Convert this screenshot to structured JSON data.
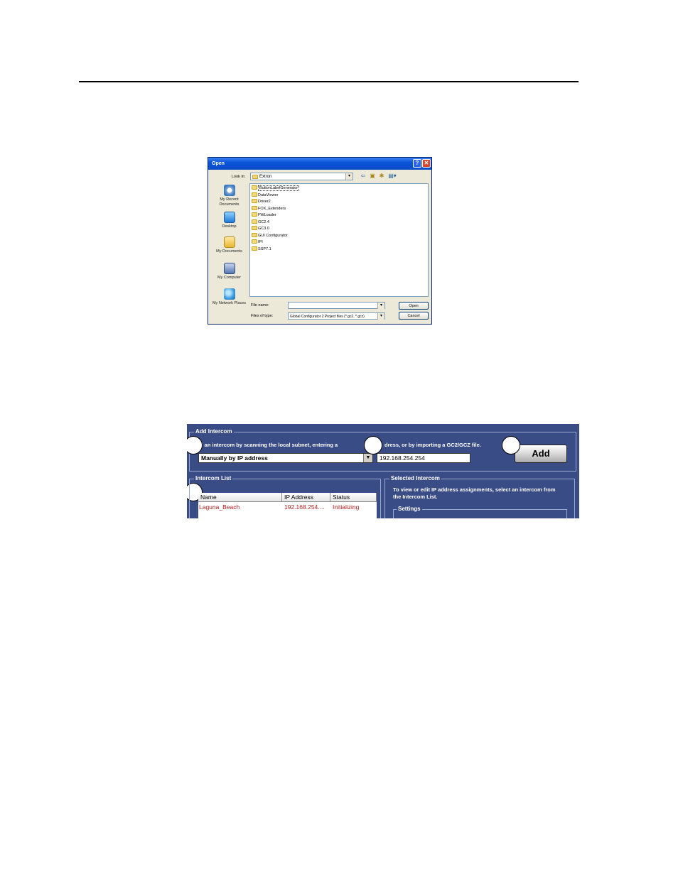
{
  "open_dialog": {
    "title": "Open",
    "look_in_label": "Look in:",
    "look_in_value": "Extron",
    "places": [
      "My Recent Documents",
      "Desktop",
      "My Documents",
      "My Computer",
      "My Network Places"
    ],
    "files": [
      "ButtonLabelGenerator",
      "DataViewer",
      "Driver2",
      "FOX_Extenders",
      "FWLoader",
      "GC2.4",
      "GC3.0",
      "GUI Configurator",
      "IPI",
      "SSP7.1"
    ],
    "file_name_label": "File name:",
    "file_name_value": "",
    "files_of_type_label": "Files of type:",
    "files_of_type_value": "Global Configurator 2 Project files (*.gc2, *.gcz)",
    "open_button": "Open",
    "cancel_button": "Cancel",
    "help_glyph": "?",
    "close_glyph": "✕"
  },
  "intercom": {
    "add_group_title": "Add Intercom",
    "instruction": "d an intercom by scanning the local subnet, entering a",
    "instruction_2": "dress, or by importing a GC2/GCZ file.",
    "method_value": "Manually by IP address",
    "ip_value": "192.168.254.254",
    "add_button": "Add",
    "list_title": "Intercom List",
    "columns": [
      "Name",
      "IP Address",
      "Status"
    ],
    "rows": [
      {
        "name": "Laguna_Beach",
        "ip": "192.168.254....",
        "status": "Initializing"
      }
    ],
    "selected_title": "Selected Intercom",
    "selected_text": "To view or edit IP address assignments, select an intercom from the Intercom List.",
    "settings_title": "Settings",
    "status_color": "#b01a1a"
  }
}
